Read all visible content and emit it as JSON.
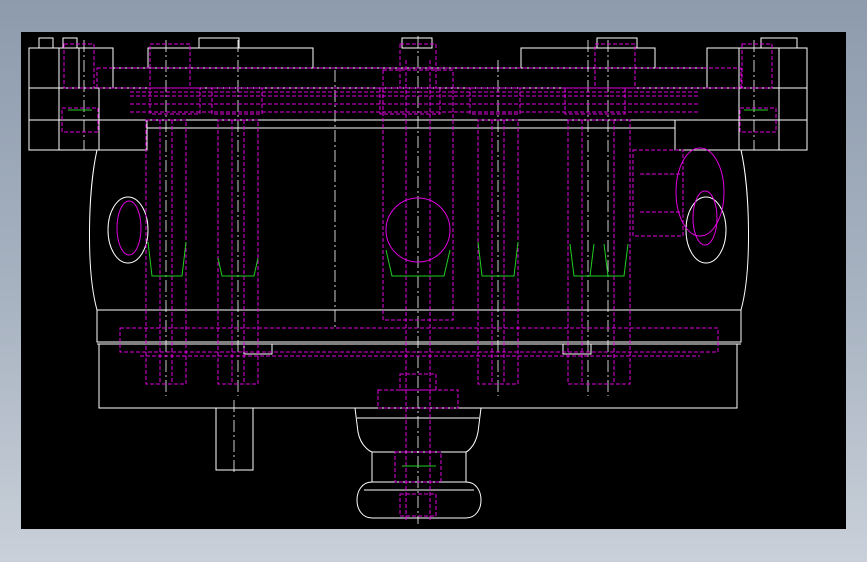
{
  "window": {
    "background_color": "#9aa7b7"
  },
  "viewport": {
    "background_color": "#000000"
  },
  "layers": [
    {
      "name": "outline",
      "color": "#ffffff",
      "linetype": "continuous"
    },
    {
      "name": "hidden",
      "color": "#e000e0",
      "linetype": "dashed"
    },
    {
      "name": "centerline",
      "color": "#ffffff",
      "linetype": "dash-dot"
    },
    {
      "name": "thread",
      "color": "#22cc22",
      "linetype": "continuous"
    }
  ]
}
